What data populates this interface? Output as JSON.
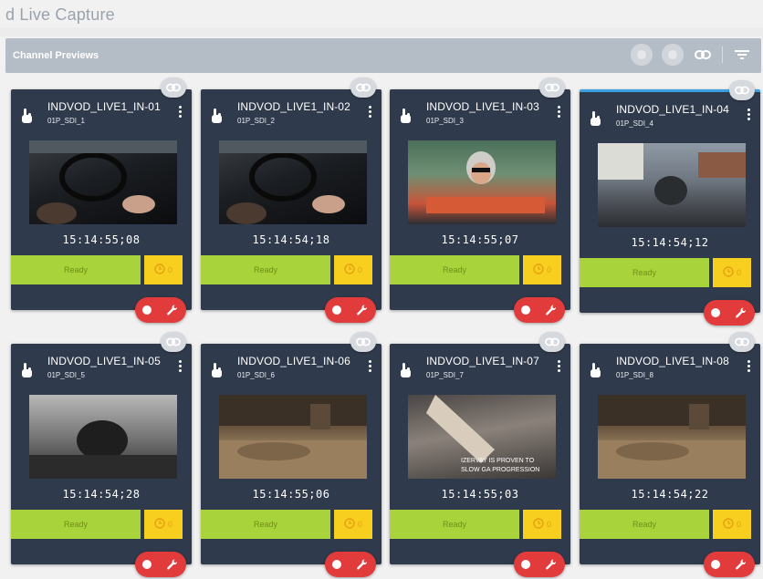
{
  "app": {
    "title": "d Live Capture"
  },
  "panel": {
    "title": "Channel Previews"
  },
  "channels": [
    {
      "name": "INDVOD_LIVE1_IN-01",
      "sub": "01P_SDI_1",
      "timecode": "15:14:55;08",
      "status": "Ready",
      "timer_count": "0",
      "scene": "car"
    },
    {
      "name": "INDVOD_LIVE1_IN-02",
      "sub": "01P_SDI_2",
      "timecode": "15:14:54;18",
      "status": "Ready",
      "timer_count": "0",
      "scene": "car"
    },
    {
      "name": "INDVOD_LIVE1_IN-03",
      "sub": "01P_SDI_3",
      "timecode": "15:14:55;07",
      "status": "Ready",
      "timer_count": "0",
      "scene": "woman"
    },
    {
      "name": "INDVOD_LIVE1_IN-04",
      "sub": "01P_SDI_4",
      "timecode": "15:14:54;12",
      "status": "Ready",
      "timer_count": "0",
      "scene": "road"
    },
    {
      "name": "INDVOD_LIVE1_IN-05",
      "sub": "01P_SDI_5",
      "timecode": "15:14:54;28",
      "status": "Ready",
      "timer_count": "0",
      "scene": "bw"
    },
    {
      "name": "INDVOD_LIVE1_IN-06",
      "sub": "01P_SDI_6",
      "timecode": "15:14:55;06",
      "status": "Ready",
      "timer_count": "0",
      "scene": "room"
    },
    {
      "name": "INDVOD_LIVE1_IN-07",
      "sub": "01P_SDI_7",
      "timecode": "15:14:55;03",
      "status": "Ready",
      "timer_count": "0",
      "scene": "leg",
      "overlay_text": "IZERVAY IS PROVEN TO SLOW GA PROGRESSION"
    },
    {
      "name": "INDVOD_LIVE1_IN-08",
      "sub": "01P_SDI_8",
      "timecode": "15:14:54;22",
      "status": "Ready",
      "timer_count": "0",
      "scene": "room"
    }
  ],
  "colors": {
    "card_bg": "#2f3a4c",
    "ready_green": "#a9d33b",
    "timer_yellow": "#f6cf1f",
    "action_red": "#e23b3b",
    "active_border": "#3aa0e0"
  },
  "icons": {
    "header": [
      "circle-icon",
      "circle-icon",
      "link-icon",
      "filter-icon"
    ],
    "card": [
      "link-icon",
      "hand-pointer-icon",
      "kebab-menu-icon",
      "clock-icon",
      "record-icon",
      "wrench-icon"
    ]
  }
}
